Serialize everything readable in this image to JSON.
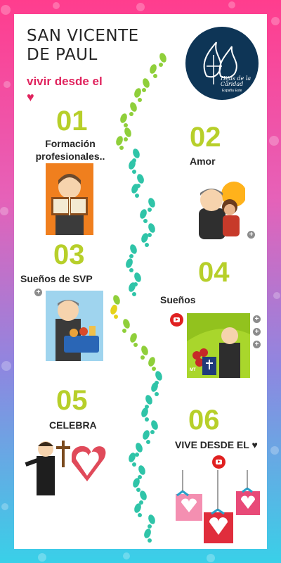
{
  "header": {
    "title_line1": "SAN VICENTE",
    "title_line2": "DE PAUL",
    "subtitle": "vivir desde el",
    "heart": "♥"
  },
  "logo": {
    "text_main": "Hijas de la Caridad",
    "text_sub": "España Este"
  },
  "sections": [
    {
      "number": "01",
      "label_line1": "Formación",
      "label_line2": "profesionales.."
    },
    {
      "number": "02",
      "label": "Amor"
    },
    {
      "number": "03",
      "label": "Sueños de SVP"
    },
    {
      "number": "04",
      "label": "Sueños"
    },
    {
      "number": "05",
      "label": "CELEBRA"
    },
    {
      "number": "06",
      "label": "VIVE DESDE EL ♥"
    }
  ],
  "badges": {
    "plus": "+",
    "pic4_tag": "MT"
  },
  "colors": {
    "number_green": "#b7cf2a",
    "accent_pink": "#e0245e",
    "logo_navy": "#0e3556",
    "youtube_red": "#e02020"
  },
  "icons": [
    "plus-icon",
    "youtube-icon",
    "heart-icon",
    "footprint-icon"
  ]
}
